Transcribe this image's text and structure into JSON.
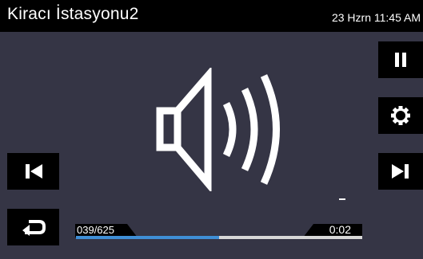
{
  "header": {
    "station_name": "Kiracı İstasyonu2",
    "datetime": "23 Hzrn 11:45 AM"
  },
  "icons": {
    "volume": "speaker-icon",
    "pause": "pause-icon",
    "settings": "gear-icon",
    "next": "skip-next-icon",
    "previous": "skip-previous-icon",
    "back": "back-arrow-icon"
  },
  "playback": {
    "track_counter": "039/625",
    "elapsed": "0:02",
    "progress": 0.5
  },
  "colors": {
    "background": "#353545",
    "bar": "#000000",
    "progress": "#3f8fd6",
    "track": "#d8d8d8"
  }
}
